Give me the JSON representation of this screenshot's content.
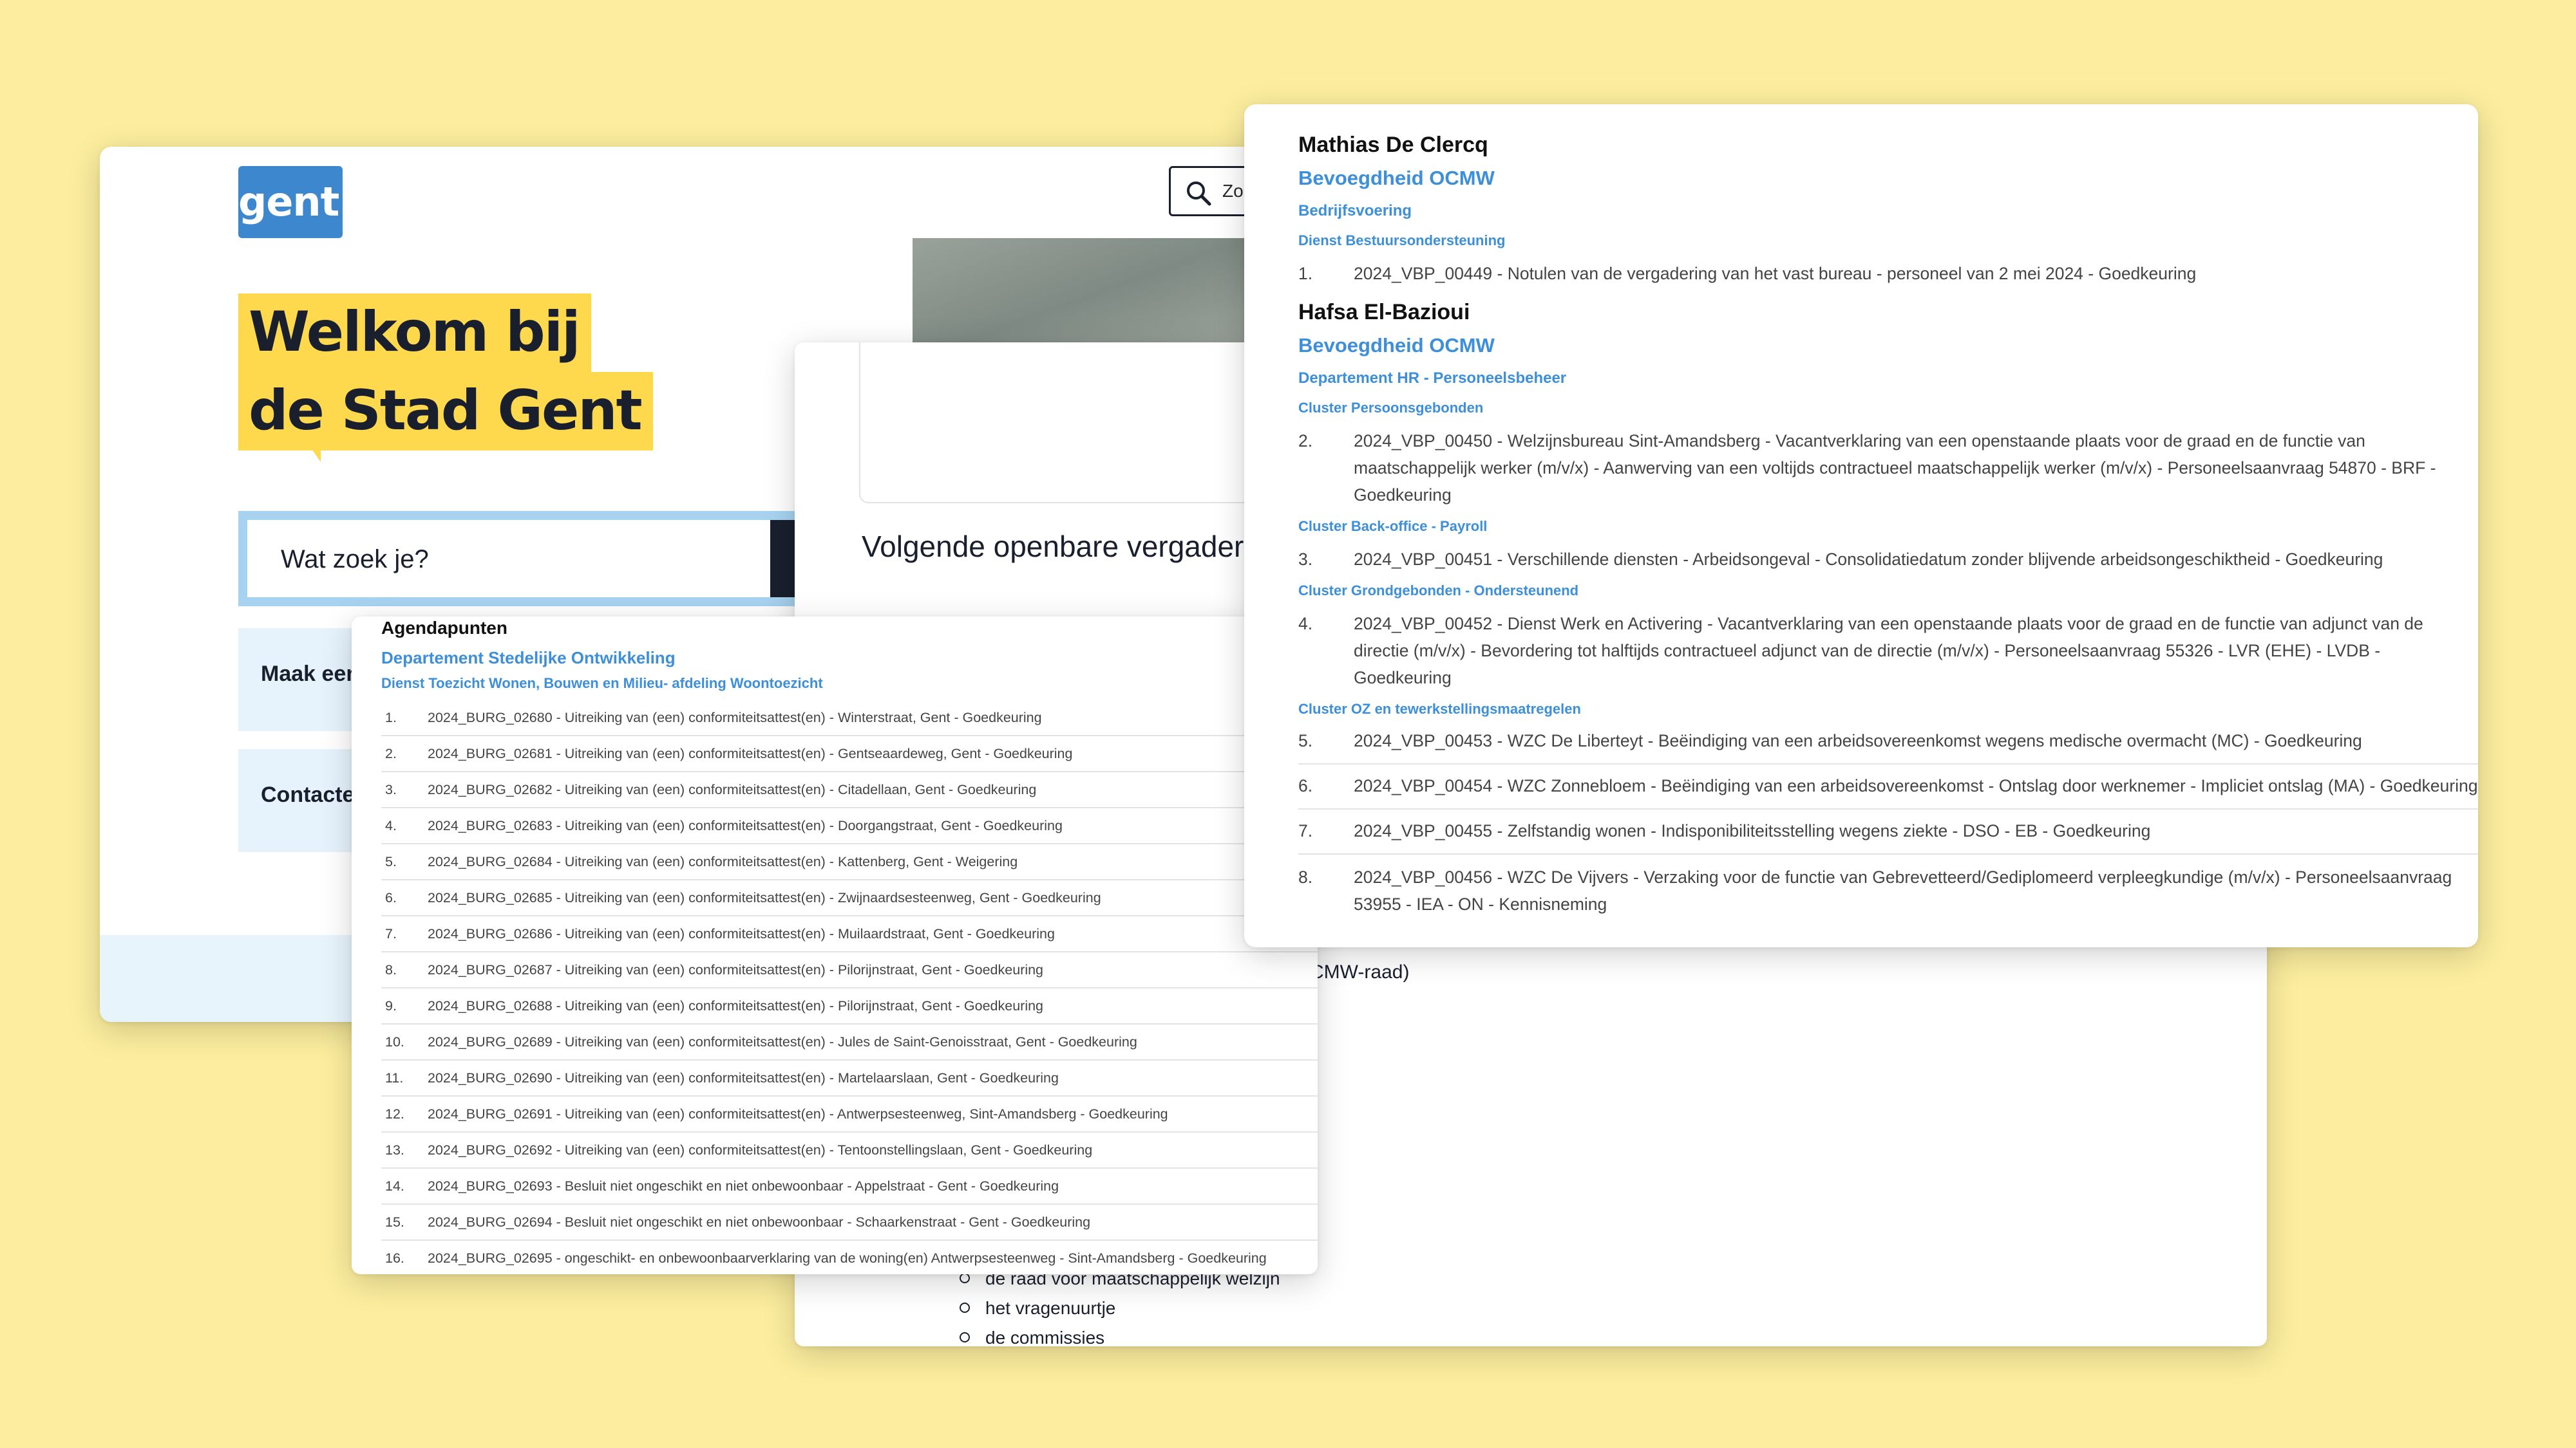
{
  "home": {
    "logo": "gent:",
    "hero_line1": "Welkom bij",
    "hero_line2": "de Stad Gent",
    "search_placeholder": "Wat zoek je?",
    "zoek_label": "Zo",
    "tiles": [
      "Maak een",
      "Contacte"
    ]
  },
  "meeting": {
    "title": "Volgende openbare vergaderi",
    "snippet": "CMW-raad)",
    "list": [
      "de raad voor maatschappelijk welzijn",
      "het vragenuurtje",
      "de commissies"
    ]
  },
  "agenda": {
    "title": "Agendapunten",
    "department": "Departement Stedelijke Ontwikkeling",
    "dienst": "Dienst Toezicht Wonen, Bouwen en Milieu- afdeling Woontoezicht",
    "items": [
      {
        "num": "1.",
        "text": "2024_BURG_02680 - Uitreiking van (een) conformiteitsattest(en) - Winterstraat, Gent - Goedkeuring"
      },
      {
        "num": "2.",
        "text": "2024_BURG_02681 - Uitreiking van (een) conformiteitsattest(en) - Gentseaardeweg, Gent - Goedkeuring"
      },
      {
        "num": "3.",
        "text": "2024_BURG_02682 - Uitreiking van (een) conformiteitsattest(en) - Citadellaan, Gent - Goedkeuring"
      },
      {
        "num": "4.",
        "text": "2024_BURG_02683 - Uitreiking van (een) conformiteitsattest(en) - Doorgangstraat, Gent - Goedkeuring"
      },
      {
        "num": "5.",
        "text": "2024_BURG_02684 - Uitreiking van (een) conformiteitsattest(en) - Kattenberg, Gent - Weigering"
      },
      {
        "num": "6.",
        "text": "2024_BURG_02685 - Uitreiking van (een) conformiteitsattest(en) - Zwijnaardsesteenweg, Gent - Goedkeuring"
      },
      {
        "num": "7.",
        "text": "2024_BURG_02686 - Uitreiking van (een) conformiteitsattest(en) - Muilaardstraat, Gent - Goedkeuring"
      },
      {
        "num": "8.",
        "text": "2024_BURG_02687 - Uitreiking van (een) conformiteitsattest(en) - Pilorijnstraat, Gent - Goedkeuring"
      },
      {
        "num": "9.",
        "text": "2024_BURG_02688 - Uitreiking van (een) conformiteitsattest(en) - Pilorijnstraat, Gent - Goedkeuring"
      },
      {
        "num": "10.",
        "text": "2024_BURG_02689 - Uitreiking van (een) conformiteitsattest(en) - Jules de Saint-Genoisstraat, Gent - Goedkeuring"
      },
      {
        "num": "11.",
        "text": "2024_BURG_02690 - Uitreiking van (een) conformiteitsattest(en) - Martelaarslaan, Gent - Goedkeuring"
      },
      {
        "num": "12.",
        "text": "2024_BURG_02691 - Uitreiking van (een) conformiteitsattest(en) - Antwerpsesteenweg, Sint-Amandsberg - Goedkeuring"
      },
      {
        "num": "13.",
        "text": "2024_BURG_02692 - Uitreiking van (een) conformiteitsattest(en) - Tentoonstellingslaan, Gent - Goedkeuring"
      },
      {
        "num": "14.",
        "text": "2024_BURG_02693 - Besluit niet ongeschikt en niet onbewoonbaar - Appelstraat - Gent - Goedkeuring"
      },
      {
        "num": "15.",
        "text": "2024_BURG_02694 - Besluit niet ongeschikt en niet onbewoonbaar - Schaarkenstraat - Gent - Goedkeuring"
      },
      {
        "num": "16.",
        "text": "2024_BURG_02695 - ongeschikt- en onbewoonbaarverklaring van de woning(en) Antwerpsesteenweg - Sint-Amandsberg - Goedkeuring"
      }
    ]
  },
  "ocmw": {
    "person1": {
      "name": "Mathias De Clercq",
      "bevoegdheid": "Bevoegdheid OCMW",
      "department": "Bedrijfsvoering",
      "dienst": "Dienst Bestuursondersteuning",
      "items": [
        {
          "num": "1.",
          "text": "2024_VBP_00449 - Notulen van de vergadering van het vast bureau - personeel van 2 mei 2024 - Goedkeuring"
        }
      ]
    },
    "person2": {
      "name": "Hafsa El-Bazioui",
      "bevoegdheid": "Bevoegdheid OCMW",
      "department": "Departement HR - Personeelsbeheer",
      "clusters": [
        {
          "name": "Cluster Persoonsgebonden",
          "items": [
            {
              "num": "2.",
              "text": "2024_VBP_00450 - Welzijnsbureau Sint-Amandsberg - Vacantverklaring van een openstaande plaats voor de graad en de functie van maatschappelijk werker (m/v/x) - Aanwerving van een voltijds contractueel maatschappelijk werker (m/v/x) - Personeelsaanvraag 54870 - BRF - Goedkeuring"
            }
          ]
        },
        {
          "name": "Cluster Back-office - Payroll",
          "items": [
            {
              "num": "3.",
              "text": "2024_VBP_00451 - Verschillende diensten - Arbeidsongeval - Consolidatiedatum zonder blijvende arbeidsongeschiktheid - Goedkeuring"
            }
          ]
        },
        {
          "name": "Cluster Grondgebonden - Ondersteunend",
          "items": [
            {
              "num": "4.",
              "text": "2024_VBP_00452 - Dienst Werk en Activering - Vacantverklaring van een openstaande plaats voor de graad en de functie van adjunct van de directie (m/v/x) - Bevordering tot halftijds contractueel adjunct van de directie (m/v/x) - Personeelsaanvraag 55326 - LVR (EHE) - LVDB - Goedkeuring"
            }
          ]
        },
        {
          "name": "Cluster OZ en tewerkstellingsmaatregelen",
          "items": [
            {
              "num": "5.",
              "text": "2024_VBP_00453 - WZC De Liberteyt - Beëindiging van een arbeidsovereenkomst wegens medische overmacht (MC) - Goedkeuring"
            },
            {
              "num": "6.",
              "text": "2024_VBP_00454 - WZC Zonnebloem - Beëindiging van een arbeidsovereenkomst - Ontslag door werknemer - Impliciet ontslag (MA) - Goedkeuring"
            },
            {
              "num": "7.",
              "text": "2024_VBP_00455 - Zelfstandig wonen - Indisponibiliteitsstelling wegens ziekte - DSO - EB - Goedkeuring"
            },
            {
              "num": "8.",
              "text": "2024_VBP_00456 - WZC De Vijvers - Verzaking voor de functie van Gebrevetteerd/Gediplomeerd verpleegkundige (m/v/x) - Personeelsaanvraag 53955 - IEA - ON - Kennisneming"
            }
          ]
        }
      ]
    }
  },
  "colors": {
    "background": "#fcee9e",
    "brand_blue": "#3c87cd",
    "hero_yellow": "#ffd94d",
    "link_blue": "#3c8fd8",
    "tile_blue": "#e6f3fc"
  }
}
